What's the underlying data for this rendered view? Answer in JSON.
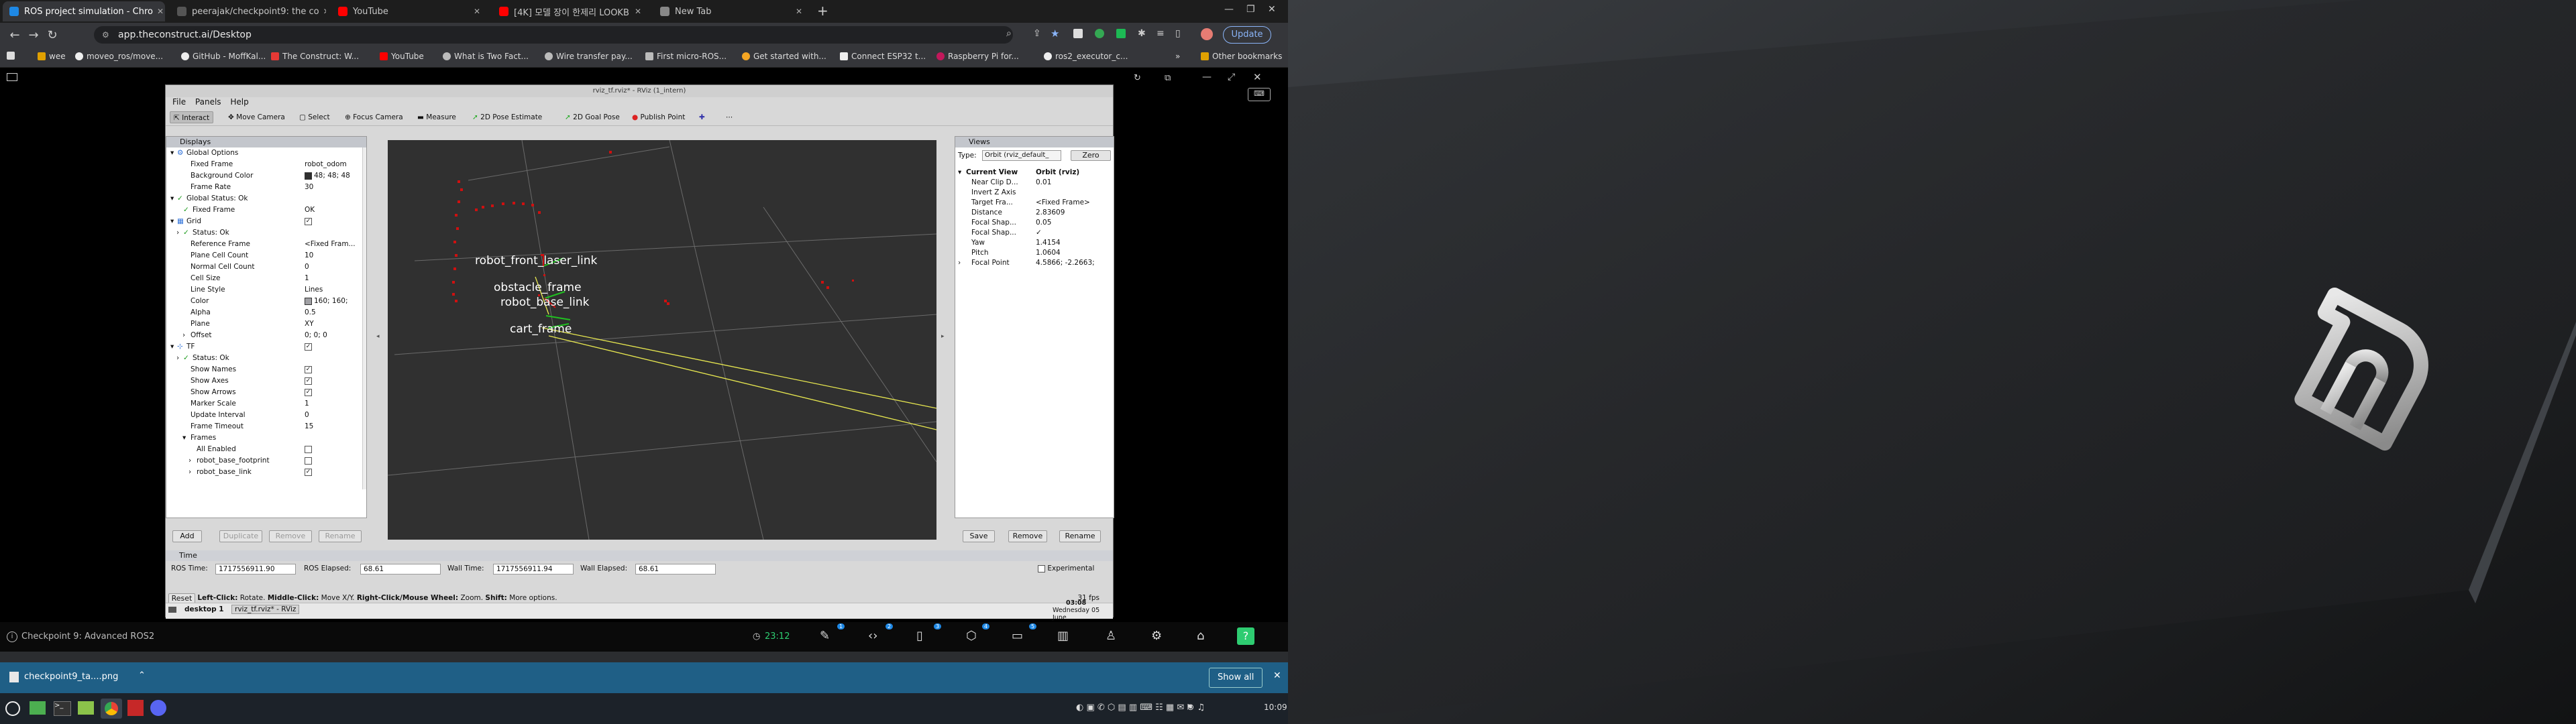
{
  "browser": {
    "tabs": [
      {
        "title": "ROS project simulation - Chro",
        "active": true,
        "icon_color": "#1e88e5"
      },
      {
        "title": "peerajak/checkpoint9: the co",
        "active": false,
        "icon_color": "#555555"
      },
      {
        "title": "YouTube",
        "active": false,
        "icon_color": "#ff0000"
      },
      {
        "title": "[4K] 모델 장이 한제리 LOOKB",
        "active": false,
        "icon_color": "#ff0000"
      },
      {
        "title": "New Tab",
        "active": false,
        "icon_color": "#888888"
      }
    ],
    "window_controls": {
      "minimize": "—",
      "maximize": "❐",
      "close": "✕"
    },
    "url": "app.theconstruct.ai/Desktop",
    "update_label": "Update",
    "bookmarks": [
      {
        "label": "wee",
        "color": "#e0a000"
      },
      {
        "label": "moveo_ros/move...",
        "color": "#eeeeee"
      },
      {
        "label": "GitHub - MoffKal...",
        "color": "#eeeeee"
      },
      {
        "label": "The Construct: W...",
        "color": "#e53935"
      },
      {
        "label": "YouTube",
        "color": "#ff0000"
      },
      {
        "label": "What is Two Fact...",
        "color": "#bbbbbb"
      },
      {
        "label": "Wire transfer pay...",
        "color": "#bbbbbb"
      },
      {
        "label": "First micro-ROS...",
        "color": "#bbbbbb"
      },
      {
        "label": "Get started with...",
        "color": "#f5a623"
      },
      {
        "label": "Connect ESP32 t...",
        "color": "#eeeeee"
      },
      {
        "label": "Raspberry Pi for...",
        "color": "#c2185b"
      },
      {
        "label": "ros2_executor_c...",
        "color": "#eeeeee"
      }
    ],
    "other_bookmarks": "Other bookmarks"
  },
  "rviz": {
    "title": "rviz_tf.rviz* - RViz (1_intern)",
    "menu": [
      "File",
      "Panels",
      "Help"
    ],
    "tools": [
      "Interact",
      "Move Camera",
      "Select",
      "Focus Camera",
      "Measure",
      "2D Pose Estimate",
      "2D Goal Pose",
      "Publish Point"
    ],
    "displays": {
      "header": "Displays",
      "rows": [
        {
          "indent": 0,
          "arrow": "▾",
          "icon": "gear",
          "key": "Global Options",
          "val": ""
        },
        {
          "indent": 2,
          "arrow": "",
          "icon": "",
          "key": "Fixed Frame",
          "val": "robot_odom"
        },
        {
          "indent": 2,
          "arrow": "",
          "icon": "",
          "key": "Background Color",
          "val": "48; 48; 48",
          "swatch": "#303030"
        },
        {
          "indent": 2,
          "arrow": "",
          "icon": "",
          "key": "Frame Rate",
          "val": "30"
        },
        {
          "indent": 0,
          "arrow": "▾",
          "icon": "ok",
          "key": "Global Status: Ok",
          "val": ""
        },
        {
          "indent": 1,
          "arrow": "",
          "icon": "ok",
          "key": "Fixed Frame",
          "val": "OK"
        },
        {
          "indent": 0,
          "arrow": "▾",
          "icon": "grid",
          "key": "Grid",
          "val": "",
          "check": true
        },
        {
          "indent": 1,
          "arrow": "›",
          "icon": "ok",
          "key": "Status: Ok",
          "val": ""
        },
        {
          "indent": 2,
          "arrow": "",
          "icon": "",
          "key": "Reference Frame",
          "val": "<Fixed Fram..."
        },
        {
          "indent": 2,
          "arrow": "",
          "icon": "",
          "key": "Plane Cell Count",
          "val": "10"
        },
        {
          "indent": 2,
          "arrow": "",
          "icon": "",
          "key": "Normal Cell Count",
          "val": "0"
        },
        {
          "indent": 2,
          "arrow": "",
          "icon": "",
          "key": "Cell Size",
          "val": "1"
        },
        {
          "indent": 2,
          "arrow": "",
          "icon": "",
          "key": "Line Style",
          "val": "Lines"
        },
        {
          "indent": 2,
          "arrow": "",
          "icon": "",
          "key": "Color",
          "val": "160; 160;",
          "swatch": "#a0a0a4"
        },
        {
          "indent": 2,
          "arrow": "",
          "icon": "",
          "key": "Alpha",
          "val": "0.5"
        },
        {
          "indent": 2,
          "arrow": "",
          "icon": "",
          "key": "Plane",
          "val": "XY"
        },
        {
          "indent": 2,
          "arrow": "›",
          "icon": "",
          "key": "Offset",
          "val": "0; 0; 0"
        },
        {
          "indent": 0,
          "arrow": "▾",
          "icon": "tf",
          "key": "TF",
          "val": "",
          "check": true
        },
        {
          "indent": 1,
          "arrow": "›",
          "icon": "ok",
          "key": "Status: Ok",
          "val": ""
        },
        {
          "indent": 2,
          "arrow": "",
          "icon": "",
          "key": "Show Names",
          "val": "",
          "check": true
        },
        {
          "indent": 2,
          "arrow": "",
          "icon": "",
          "key": "Show Axes",
          "val": "",
          "check": true
        },
        {
          "indent": 2,
          "arrow": "",
          "icon": "",
          "key": "Show Arrows",
          "val": "",
          "check": true
        },
        {
          "indent": 2,
          "arrow": "",
          "icon": "",
          "key": "Marker Scale",
          "val": "1"
        },
        {
          "indent": 2,
          "arrow": "",
          "icon": "",
          "key": "Update Interval",
          "val": "0"
        },
        {
          "indent": 2,
          "arrow": "",
          "icon": "",
          "key": "Frame Timeout",
          "val": "15"
        },
        {
          "indent": 2,
          "arrow": "▾",
          "icon": "",
          "key": "Frames",
          "val": ""
        },
        {
          "indent": 3,
          "arrow": "",
          "icon": "",
          "key": "All Enabled",
          "val": "",
          "check": false
        },
        {
          "indent": 3,
          "arrow": "›",
          "icon": "",
          "key": "robot_base_footprint",
          "val": "",
          "check": false
        },
        {
          "indent": 3,
          "arrow": "›",
          "icon": "",
          "key": "robot_base_link",
          "val": "",
          "check": true
        }
      ],
      "buttons": {
        "add": "Add",
        "duplicate": "Duplicate",
        "remove": "Remove",
        "rename": "Rename"
      }
    },
    "viewport": {
      "frame_labels": [
        "robot_front_laser_link",
        "obstacle_frame",
        "robot_base_link",
        "cart_frame"
      ]
    },
    "views": {
      "header": "Views",
      "type_label": "Type:",
      "type_value": "Orbit (rviz_default_",
      "zero_label": "Zero",
      "rows": [
        {
          "key": "Current View",
          "val": "Orbit (rviz)",
          "bold": true,
          "arrow": "▾"
        },
        {
          "key": "Near Clip D...",
          "val": "0.01"
        },
        {
          "key": "Invert Z Axis",
          "val": ""
        },
        {
          "key": "Target Fra...",
          "val": "<Fixed Frame>"
        },
        {
          "key": "Distance",
          "val": "2.83609"
        },
        {
          "key": "Focal Shap...",
          "val": "0.05"
        },
        {
          "key": "Focal Shap...",
          "val": "✓"
        },
        {
          "key": "Yaw",
          "val": "1.4154"
        },
        {
          "key": "Pitch",
          "val": "1.0604"
        },
        {
          "key": "Focal Point",
          "val": "4.5866; -2.2663;",
          "arrow": "›"
        }
      ],
      "buttons": {
        "save": "Save",
        "remove": "Remove",
        "rename": "Rename"
      }
    },
    "time": {
      "header": "Time",
      "ros_time_label": "ROS Time:",
      "ros_time": "1717556911.90",
      "ros_elapsed_label": "ROS Elapsed:",
      "ros_elapsed": "68.61",
      "wall_time_label": "Wall Time:",
      "wall_time": "1717556911.94",
      "wall_elapsed_label": "Wall Elapsed:",
      "wall_elapsed": "68.61",
      "experimental": "Experimental"
    },
    "status": {
      "reset": "Reset",
      "hint_left_bold": "Left-Click:",
      "hint_left": "Rotate.",
      "hint_mid_bold": "Middle-Click:",
      "hint_mid": "Move X/Y.",
      "hint_right_bold": "Right-Click/Mouse Wheel:",
      "hint_right": "Zoom.",
      "hint_shift_bold": "Shift:",
      "hint_shift": "More options.",
      "fps": "31 fps"
    },
    "xtaskbar": {
      "desktop": "desktop 1",
      "window": "rviz_tf.rviz* - RViz",
      "time": "03:08",
      "date": "Wednesday 05 June"
    }
  },
  "course_bar": {
    "title": "Checkpoint 9: Advanced ROS2",
    "timer": "23:12",
    "badges": [
      "1",
      "2",
      "3",
      "4",
      "5"
    ]
  },
  "downloads": {
    "file": "checkpoint9_ta....png",
    "show_all": "Show all"
  },
  "os_taskbar": {
    "clock": "10:09",
    "lang": "KR"
  }
}
